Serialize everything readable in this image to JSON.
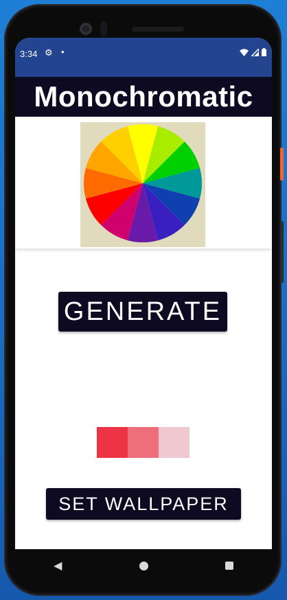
{
  "status_bar": {
    "time": "3:34",
    "icons": [
      "gear-icon",
      "dot-icon",
      "wifi-icon",
      "signal-icon",
      "battery-icon"
    ]
  },
  "app": {
    "title": "Monochromatic",
    "generate_label": "GENERATE",
    "set_wallpaper_label": "SET WALLPAPER"
  },
  "color_wheel": {
    "segments": [
      "#ffff00",
      "#a8ec00",
      "#00d000",
      "#009999",
      "#1040b0",
      "#3a1fc0",
      "#6a1aa8",
      "#d0006f",
      "#ff0000",
      "#ff6b00",
      "#ffa500",
      "#ffd000"
    ]
  },
  "swatches": [
    {
      "color": "#ee3345"
    },
    {
      "color": "#ee6f7b"
    },
    {
      "color": "#f0c9d0"
    }
  ],
  "nav": [
    "back-icon",
    "home-icon",
    "recents-icon"
  ],
  "colors": {
    "status_bar": "#23448e",
    "title_bar": "#0e0a22",
    "button": "#0e0a22"
  }
}
